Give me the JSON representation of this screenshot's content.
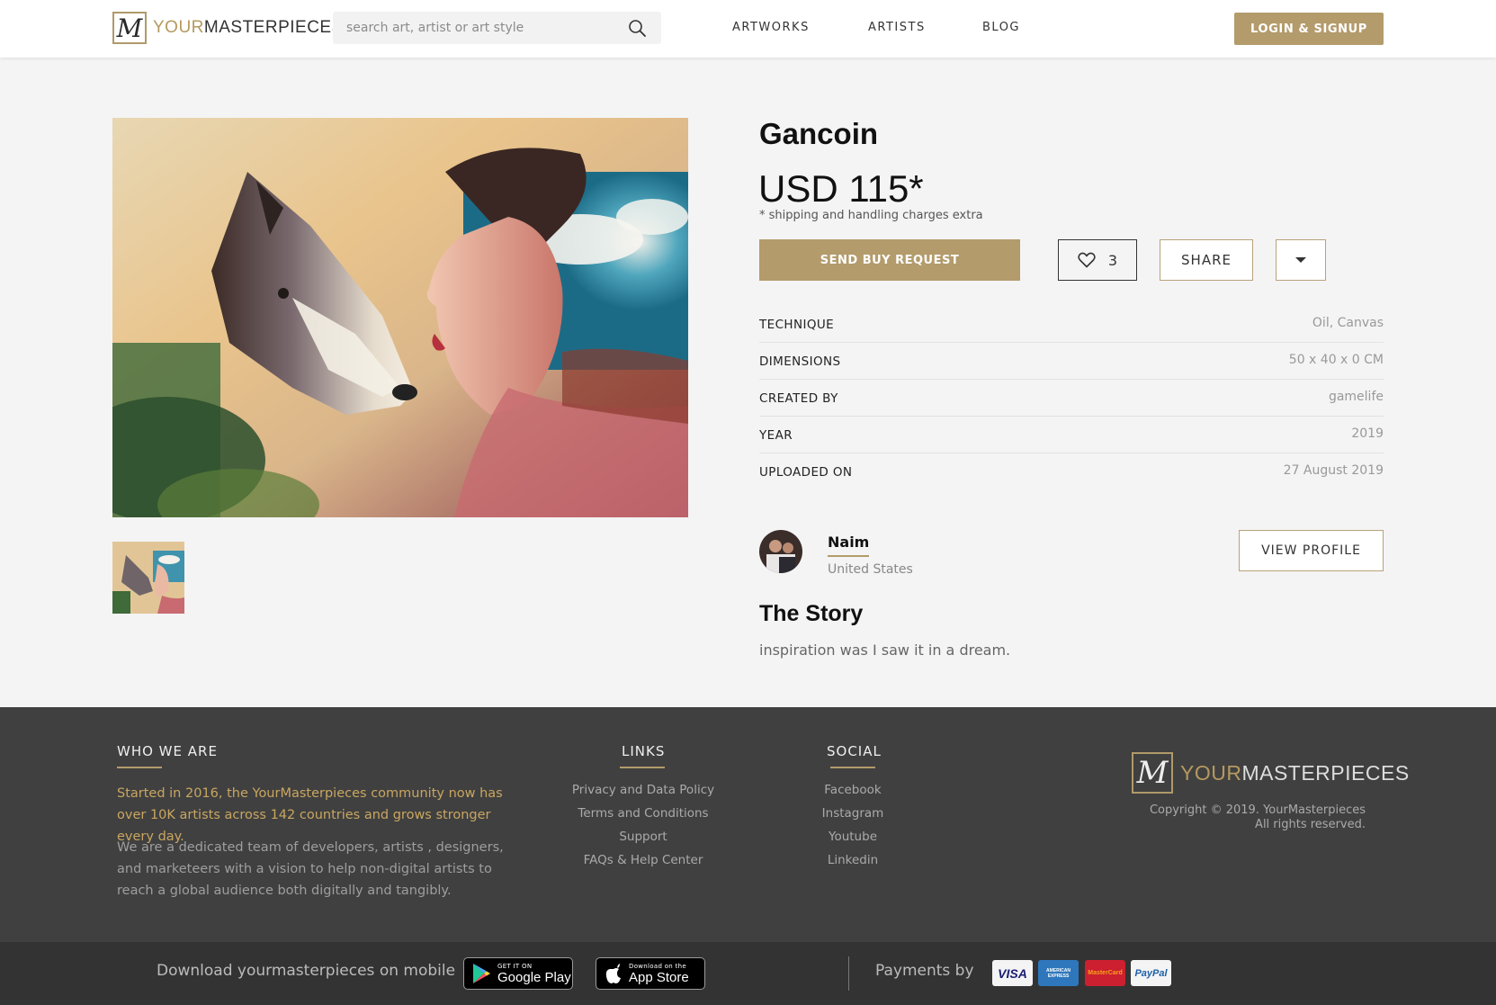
{
  "header": {
    "logo": {
      "prefix": "YOUR",
      "suffix": "MASTERPIECES",
      "mark": "M"
    },
    "search": {
      "placeholder": "search art, artist or art style",
      "icon": "search-icon"
    },
    "nav": [
      {
        "label": "ARTWORKS"
      },
      {
        "label": "ARTISTS"
      },
      {
        "label": "BLOG"
      }
    ],
    "login_label": "LOGIN & SIGNUP"
  },
  "artwork": {
    "title": "Gancoin",
    "price": "USD 115*",
    "shipping_note": "* shipping and handling charges extra",
    "buy_label": "SEND BUY REQUEST",
    "likes": "3",
    "share_label": "SHARE",
    "specs": [
      {
        "label": "TECHNIQUE",
        "value": "Oil, Canvas"
      },
      {
        "label": "DIMENSIONS",
        "value": "50 x 40 x 0 CM"
      },
      {
        "label": "CREATED BY",
        "value": "gamelife"
      },
      {
        "label": "YEAR",
        "value": "2019"
      },
      {
        "label": "UPLOADED ON",
        "value": "27 August 2019"
      }
    ]
  },
  "artist": {
    "name": "Naim",
    "country": "United States",
    "view_profile_label": "VIEW PROFILE"
  },
  "story": {
    "title": "The Story",
    "text": "inspiration was I saw it in a dream."
  },
  "footer": {
    "who_we_are": {
      "heading": "WHO WE ARE",
      "intro": "Started in 2016, the YourMasterpieces community now has over 10K artists across 142 countries and grows stronger every day.",
      "desc": "We are a dedicated team of developers, artists , designers, and marketeers with a vision to help non-digital artists to reach a global audience both digitally and tangibly."
    },
    "links": {
      "heading": "LINKS",
      "items": [
        "Privacy and Data Policy",
        "Terms and Conditions",
        "Support",
        "FAQs & Help Center"
      ]
    },
    "social": {
      "heading": "SOCIAL",
      "items": [
        "Facebook",
        "Instagram",
        "Youtube",
        "Linkedin"
      ]
    },
    "copyright_line1": "Copyright © 2019. YourMasterpieces",
    "copyright_line2": "All rights reserved."
  },
  "bottom": {
    "download_text": "Download yourmasterpieces on mobile",
    "google_play": {
      "small": "GET IT ON",
      "big": "Google Play"
    },
    "app_store": {
      "small": "Download on the",
      "big": "App Store"
    },
    "payments_text": "Payments by",
    "cards": [
      {
        "name": "VISA",
        "bg": "#f4f4f4",
        "fg": "#1a1f71"
      },
      {
        "name": "AMERICAN EXPRESS",
        "bg": "#2e77bc",
        "fg": "#ffffff"
      },
      {
        "name": "MasterCard",
        "bg": "#cc1f2f",
        "fg": "#f7a21b"
      },
      {
        "name": "PayPal",
        "bg": "#f4f4f4",
        "fg": "#1b5fa8"
      }
    ]
  },
  "colors": {
    "accent": "#b39b6b",
    "footer_bg": "#404040",
    "bottom_bg": "#333333"
  }
}
